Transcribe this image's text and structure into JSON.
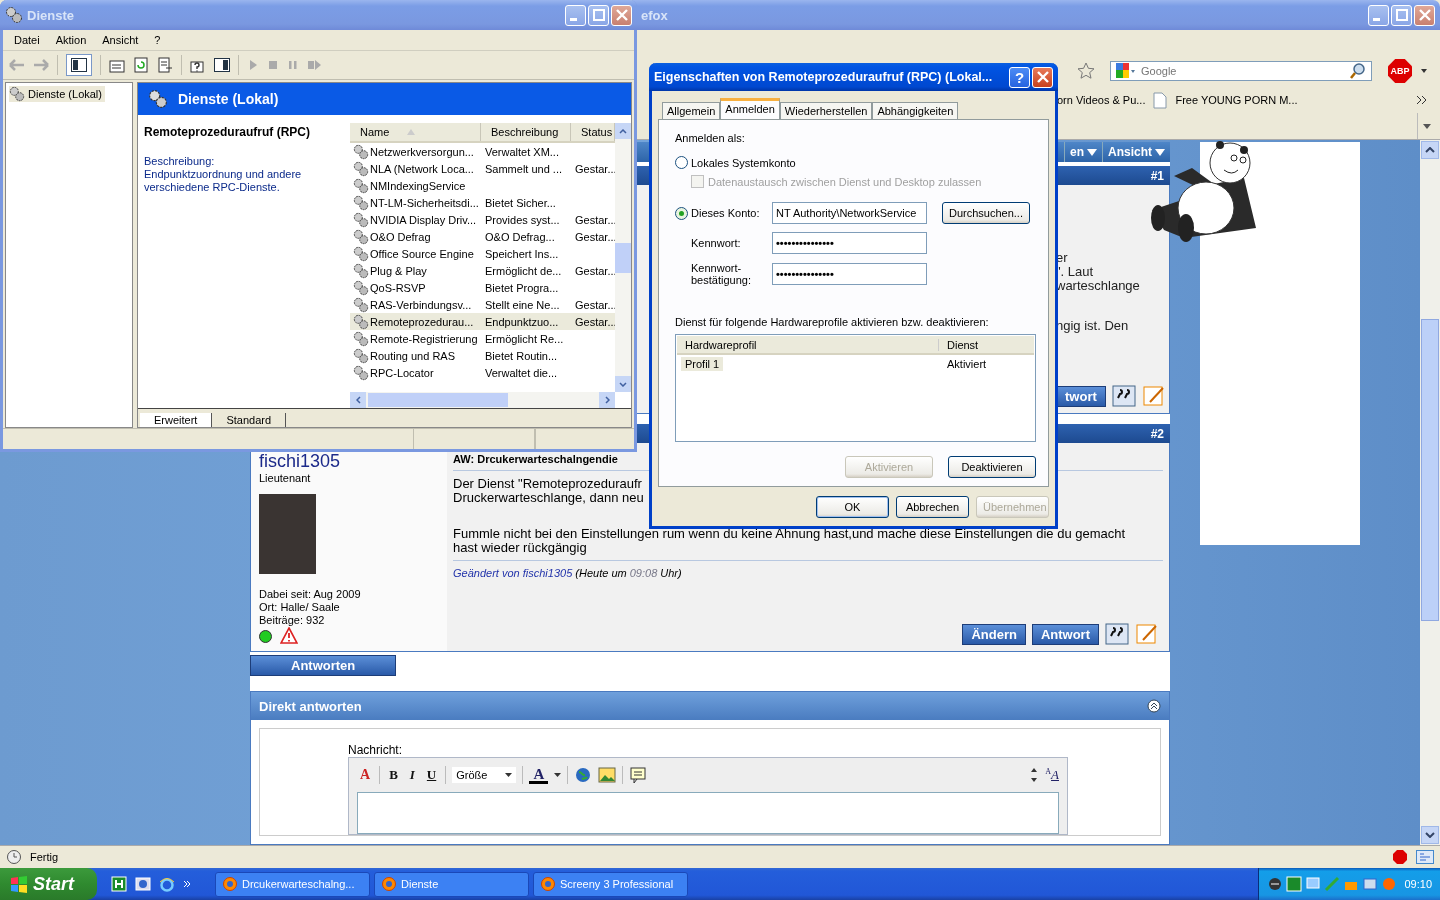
{
  "browser": {
    "title": "efox",
    "search_placeholder": "Google",
    "adblock": "ABP",
    "bookmarks": [
      {
        "label": "orn Videos & Pu...",
        "icon": false
      },
      {
        "label": "Free YOUNG PORN M...",
        "icon": true
      }
    ],
    "status": "Fertig"
  },
  "forum": {
    "nav": [
      "en",
      "Ansicht"
    ],
    "post1": {
      "number": "#1",
      "lines": [
        "er",
        "\". Laut",
        "warteschlange"
      ],
      "line2": "ngig ist. Den",
      "button": "twort"
    },
    "post2": {
      "number": "#2",
      "user": "fischi1305",
      "rank": "Lieutenant",
      "online": true,
      "info": [
        "Dabei seit: Aug 2009",
        "Ort: Halle/ Saale",
        "Beiträge: 932"
      ],
      "title": "AW: Drcukerwarteschalngendie",
      "lines": [
        "Der Dienst \"Remoteprozeduraufr",
        "Druckerwarteschlange, dann neu"
      ],
      "paragraph": "Fummle nicht bei den Einstellungen rum wenn du keine Ahnung hast,und mache diese Einstellungen die du gemacht hast wieder rückgängig",
      "edited_by": "Geändert von fischi1305",
      "edited_pre": "(Heute um",
      "edited_time": "09:08",
      "edited_post": "Uhr)",
      "buttons": [
        "Ändern",
        "Antwort"
      ]
    },
    "reply_button": "Antworten",
    "quick_reply": {
      "title": "Direkt antworten",
      "label": "Nachricht:",
      "size": "Größe",
      "letters": {
        "clear": "A",
        "bold": "B",
        "italic": "I",
        "underline": "U",
        "fg": "A",
        "small": "A",
        "large": "A"
      }
    }
  },
  "services": {
    "title": "Dienste",
    "menu": [
      "Datei",
      "Aktion",
      "Ansicht",
      "?"
    ],
    "tree": "Dienste (Lokal)",
    "header": "Dienste (Lokal)",
    "name": "Remoteprozeduraufruf (RPC)",
    "desc_label": "Beschreibung:",
    "desc": "Endpunktzuordnung und andere verschiedene RPC-Dienste.",
    "columns": [
      "Name",
      "Beschreibung",
      "Status"
    ],
    "rows": [
      {
        "name": "Netzwerkversorgun...",
        "desc": "Verwaltet XM...",
        "status": "",
        "selected": false
      },
      {
        "name": "NLA (Network Loca...",
        "desc": "Sammelt und ...",
        "status": "Gestar...",
        "selected": false
      },
      {
        "name": "NMIndexingService",
        "desc": "",
        "status": "",
        "selected": false
      },
      {
        "name": "NT-LM-Sicherheitsdi...",
        "desc": "Bietet Sicher...",
        "status": "",
        "selected": false
      },
      {
        "name": "NVIDIA Display Driv...",
        "desc": "Provides syst...",
        "status": "Gestar...",
        "selected": false
      },
      {
        "name": "O&O Defrag",
        "desc": "O&O Defrag...",
        "status": "Gestar...",
        "selected": false
      },
      {
        "name": "Office Source Engine",
        "desc": "Speichert Ins...",
        "status": "",
        "selected": false
      },
      {
        "name": "Plug & Play",
        "desc": "Ermöglicht de...",
        "status": "Gestar...",
        "selected": false
      },
      {
        "name": "QoS-RSVP",
        "desc": "Bietet Progra...",
        "status": "",
        "selected": false
      },
      {
        "name": "RAS-Verbindungsv...",
        "desc": "Stellt eine Ne...",
        "status": "Gestar...",
        "selected": false
      },
      {
        "name": "Remoteprozedurau...",
        "desc": "Endpunktzuo...",
        "status": "Gestar...",
        "selected": true
      },
      {
        "name": "Remote-Registrierung",
        "desc": "Ermöglicht Re...",
        "status": "",
        "selected": false
      },
      {
        "name": "Routing und RAS",
        "desc": "Bietet Routin...",
        "status": "",
        "selected": false
      },
      {
        "name": "RPC-Locator",
        "desc": "Verwaltet die...",
        "status": "",
        "selected": false
      }
    ],
    "tabs": [
      {
        "label": "Erweitert",
        "selected": true
      },
      {
        "label": "Standard",
        "selected": false
      }
    ]
  },
  "dialog": {
    "title": "Eigenschaften von Remoteprozeduraufruf (RPC) (Lokal...",
    "help": "?",
    "tabs": [
      {
        "label": "Allgemein",
        "selected": false
      },
      {
        "label": "Anmelden",
        "selected": true
      },
      {
        "label": "Wiederherstellen",
        "selected": false
      },
      {
        "label": "Abhängigkeiten",
        "selected": false
      }
    ],
    "logon_label": "Anmelden als:",
    "radios": [
      {
        "label": "Lokales Systemkonto",
        "selected": false
      },
      {
        "label": "Dieses Konto:",
        "selected": true
      }
    ],
    "checkbox": {
      "label": "Datenaustausch zwischen Dienst und Desktop zulassen",
      "checked": false,
      "disabled": true
    },
    "account": "NT Authority\\NetworkService",
    "browse": "Durchsuchen...",
    "password_label": "Kennwort:",
    "password": "•••••••••••••••",
    "confirm_label": "Kennwort-\nbestätigung:",
    "confirm": "•••••••••••••••",
    "profiles_label": "Dienst für folgende Hardwareprofile aktivieren bzw. deaktivieren:",
    "profile_columns": [
      "Hardwareprofil",
      "Dienst"
    ],
    "profiles": [
      {
        "name": "Profil 1",
        "service": "Aktiviert"
      }
    ],
    "profile_buttons": [
      {
        "label": "Aktivieren",
        "disabled": true
      },
      {
        "label": "Deaktivieren",
        "disabled": false
      }
    ],
    "buttons": [
      {
        "label": "OK",
        "disabled": false
      },
      {
        "label": "Abbrechen",
        "disabled": false
      },
      {
        "label": "Übernehmen",
        "disabled": true
      }
    ]
  },
  "taskbar": {
    "start": "Start",
    "tasks": [
      "Drcukerwarteschalng...",
      "Dienste",
      "Screeny 3 Professional"
    ],
    "clock": "09:10"
  }
}
